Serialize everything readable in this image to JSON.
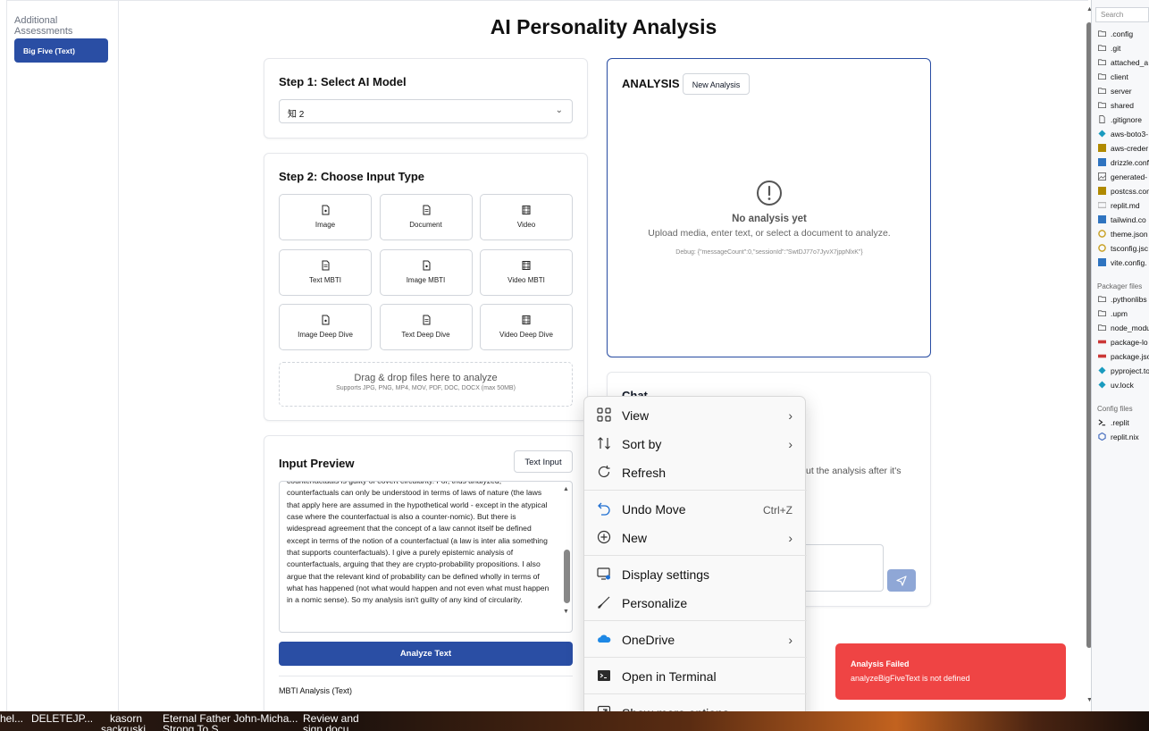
{
  "sidebar": {
    "heading": "Additional Assessments",
    "active_item": "Big Five (Text)"
  },
  "page_title": "AI Personality Analysis",
  "step1": {
    "title": "Step 1: Select AI Model",
    "selected_model": "知 2"
  },
  "step2": {
    "title": "Step 2: Choose Input Type",
    "types": [
      {
        "label": "Image",
        "icon": "image-file-icon"
      },
      {
        "label": "Document",
        "icon": "document-icon"
      },
      {
        "label": "Video",
        "icon": "film-icon"
      },
      {
        "label": "Text MBTI",
        "icon": "document-icon"
      },
      {
        "label": "Image MBTI",
        "icon": "image-file-icon"
      },
      {
        "label": "Video MBTI",
        "icon": "film-icon"
      },
      {
        "label": "Image Deep Dive",
        "icon": "image-file-icon"
      },
      {
        "label": "Text Deep Dive",
        "icon": "document-icon"
      },
      {
        "label": "Video Deep Dive",
        "icon": "film-icon"
      }
    ],
    "dropzone_main": "Drag & drop files here to analyze",
    "dropzone_sub": "Supports JPG, PNG, MP4, MOV, PDF, DOC, DOCX (max 50MB)"
  },
  "input_preview": {
    "title": "Input Preview",
    "text_input_label": "Text Input",
    "text": "counterfactuals is guilty of covert circularity. For, thus analyzed, counterfactuals can only be understood in terms of laws of nature (the laws that apply here are assumed in the hypothetical world - except in the atypical case where the counterfactual is also a counter-nomic). But there is widespread agreement that the concept of a law cannot itself be defined except in terms of the notion of a counterfactual (a law is inter alia something that supports counterfactuals). I give a purely epistemic analysis of counterfactuals, arguing that they are crypto-probability propositions. I also argue that the relevant kind of probability can be defined wholly in terms of what has happened (not what would happen and not even what must happen in a nomic sense). So my analysis isn't guilty of any kind of circularity.",
    "analyze_label": "Analyze Text",
    "mbti_label": "MBTI Analysis (Text)"
  },
  "analysis": {
    "title": "ANALYSIS",
    "new_label": "New Analysis",
    "empty_title": "No analysis yet",
    "empty_sub": "Upload media, enter text, or select a document to analyze.",
    "debug": "Debug: {\"messageCount\":0,\"sessionId\":\"SwtDJ77o7JyvX7jppNlxK\"}"
  },
  "chat": {
    "title": "Chat",
    "hint": "ut the analysis after it's"
  },
  "file_panel": {
    "search_placeholder": "Search",
    "items": [
      {
        "name": ".config",
        "icon": "folder-icon",
        "color": "#555555"
      },
      {
        "name": ".git",
        "icon": "folder-icon",
        "color": "#555555"
      },
      {
        "name": "attached_a",
        "icon": "folder-icon",
        "color": "#555555"
      },
      {
        "name": "client",
        "icon": "folder-icon",
        "color": "#555555"
      },
      {
        "name": "server",
        "icon": "folder-icon",
        "color": "#555555"
      },
      {
        "name": "shared",
        "icon": "folder-icon",
        "color": "#555555"
      },
      {
        "name": ".gitignore",
        "icon": "file-icon",
        "color": "#555555"
      },
      {
        "name": "aws-boto3-",
        "icon": "python-icon",
        "color": "#1a9bbf"
      },
      {
        "name": "aws-creder",
        "icon": "js-icon",
        "color": "#b08a00"
      },
      {
        "name": "drizzle.conf",
        "icon": "ts-icon",
        "color": "#2f74c0"
      },
      {
        "name": "generated-",
        "icon": "image-icon",
        "color": "#555555"
      },
      {
        "name": "postcss.con",
        "icon": "js-icon",
        "color": "#b08a00"
      },
      {
        "name": "replit.md",
        "icon": "markdown-icon",
        "color": "#888888"
      },
      {
        "name": "tailwind.co",
        "icon": "ts-icon",
        "color": "#2f74c0"
      },
      {
        "name": "theme.json",
        "icon": "json-icon",
        "color": "#c9a227"
      },
      {
        "name": "tsconfig.jsc",
        "icon": "json-icon",
        "color": "#c9a227"
      },
      {
        "name": "vite.config.",
        "icon": "ts-icon",
        "color": "#2f74c0"
      }
    ],
    "packager_heading": "Packager files",
    "packager_items": [
      {
        "name": ".pythonlibs",
        "icon": "folder-icon",
        "color": "#555555"
      },
      {
        "name": ".upm",
        "icon": "folder-icon",
        "color": "#555555"
      },
      {
        "name": "node_modul",
        "icon": "folder-icon",
        "color": "#555555"
      },
      {
        "name": "package-lo",
        "icon": "npm-icon",
        "color": "#cb3837"
      },
      {
        "name": "package.jso",
        "icon": "npm-icon",
        "color": "#cb3837"
      },
      {
        "name": "pyproject.to",
        "icon": "python-icon",
        "color": "#1a9bbf"
      },
      {
        "name": "uv.lock",
        "icon": "python-icon",
        "color": "#1a9bbf"
      }
    ],
    "config_heading": "Config files",
    "config_items": [
      {
        "name": ".replit",
        "icon": "terminal-icon",
        "color": "#222222"
      },
      {
        "name": "replit.nix",
        "icon": "nix-icon",
        "color": "#5277c3"
      }
    ]
  },
  "context_menu": {
    "items": [
      {
        "label": "View",
        "icon": "grid-icon",
        "submenu": true
      },
      {
        "label": "Sort by",
        "icon": "sort-icon",
        "submenu": true
      },
      {
        "label": "Refresh",
        "icon": "refresh-icon",
        "submenu": false
      },
      {
        "label": "Undo Move",
        "icon": "undo-icon",
        "shortcut": "Ctrl+Z"
      },
      {
        "label": "New",
        "icon": "plus-circle-icon",
        "submenu": true
      },
      {
        "label": "Display settings",
        "icon": "display-settings-icon"
      },
      {
        "label": "Personalize",
        "icon": "brush-icon"
      },
      {
        "label": "OneDrive",
        "icon": "onedrive-icon",
        "submenu": true
      },
      {
        "label": "Open in Terminal",
        "icon": "terminal-icon"
      },
      {
        "label": "Show more options",
        "icon": "more-options-icon"
      }
    ]
  },
  "toast": {
    "title": "Analysis Failed",
    "message": "analyzeBigFiveText is not defined"
  },
  "taskbar": {
    "items": [
      {
        "line1": "hel...",
        "line2": ""
      },
      {
        "line1": "DELETEJP...",
        "line2": ""
      },
      {
        "line1": "kasorn",
        "line2": "sackruski"
      },
      {
        "line1": "Eternal Father John-Micha...",
        "line2": "Strong To S..."
      },
      {
        "line1": "Review and",
        "line2": "sign docu..."
      }
    ]
  },
  "colors": {
    "primary": "#2a4ea4",
    "error": "#ef4444",
    "border": "#e5e7eb"
  }
}
